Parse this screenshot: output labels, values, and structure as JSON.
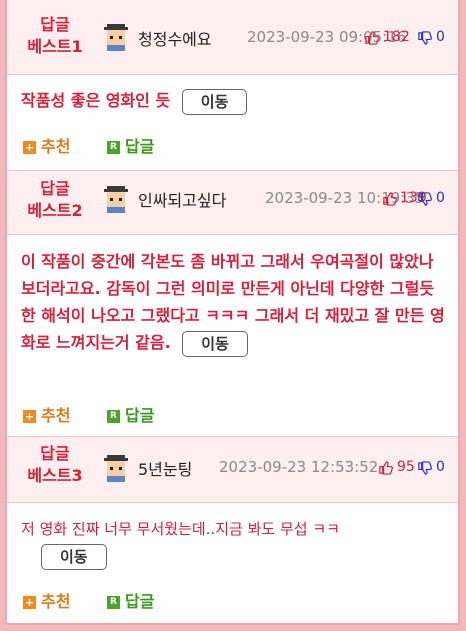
{
  "colors": {
    "accent": "#d8203a",
    "header_bg": "#fdeef0",
    "frame": "#f0a7ad",
    "downvote": "#2233cc",
    "recommend": "#e07a12",
    "reply": "#3b9a1d"
  },
  "icons": {
    "avatar": "pixel-avatar-icon",
    "upvote": "thumbs-up-icon",
    "downvote": "thumbs-down-icon",
    "recommend": "plus-icon",
    "reply": "r-icon"
  },
  "move_label": "이동",
  "recommend_label": "추천",
  "reply_label": "답글",
  "recommend_glyph": "+",
  "reply_glyph": "R",
  "replies": [
    {
      "rank_line1": "답글",
      "rank_line2": "베스트1",
      "nickname": "청정수에요",
      "date": "2023-09-23 09:05:16",
      "upvotes": "182",
      "downvotes": "0",
      "text": "작품성 좋은 영화인 듯"
    },
    {
      "rank_line1": "답글",
      "rank_line2": "베스트2",
      "nickname": "인싸되고싶다",
      "date": "2023-09-23 10:19:35",
      "upvotes": "139",
      "downvotes": "0",
      "text": "이 작품이 중간에 각본도 좀 바뀌고 그래서 우여곡절이 많았나보더라고요. 감독이 그런 의미로 만든게 아닌데 다양한 그럴듯한 해석이 나오고 그랬다고 ㅋㅋㅋ 그래서 더 재밌고 잘 만든 영화로 느껴지는거 같음."
    },
    {
      "rank_line1": "답글",
      "rank_line2": "베스트3",
      "nickname": "5년눈팅",
      "date": "2023-09-23 12:53:52",
      "upvotes": "95",
      "downvotes": "0",
      "text": "저 영화 진짜 너무 무서웠는데..지금 봐도 무섭 ㅋㅋ"
    }
  ]
}
